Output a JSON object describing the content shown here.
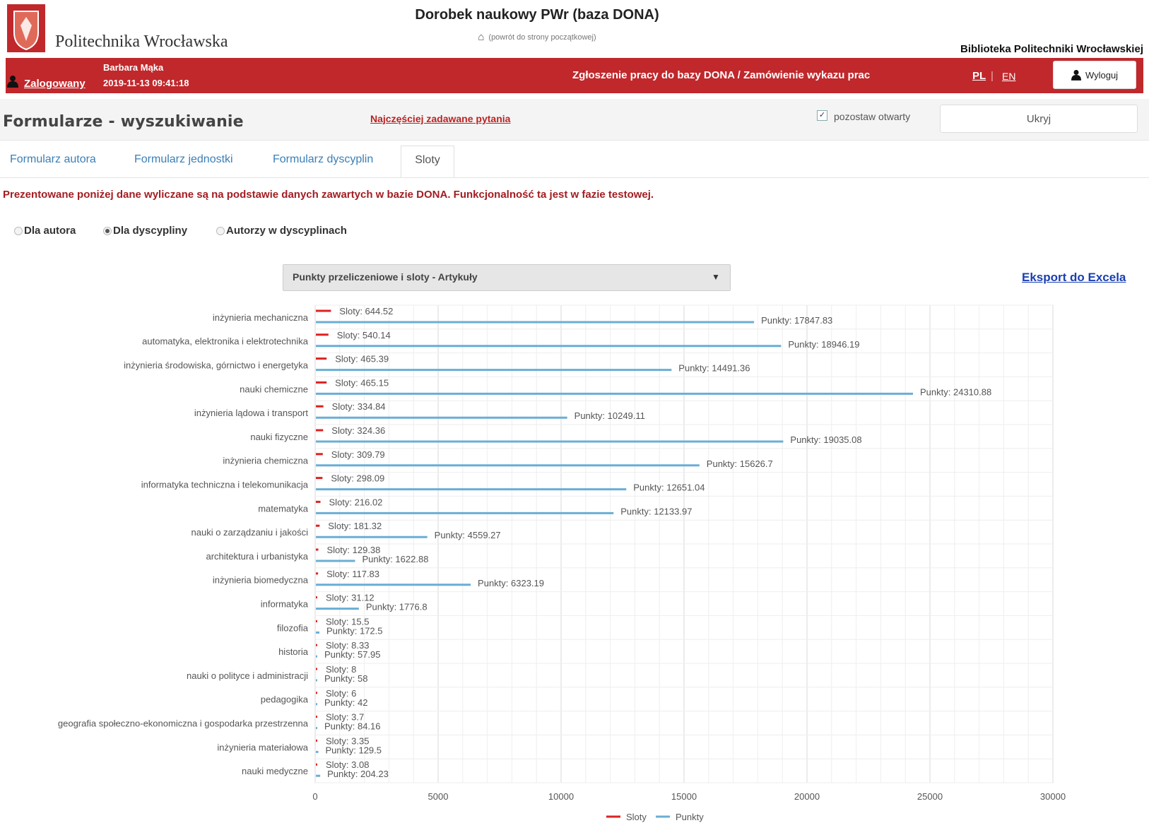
{
  "header": {
    "logo_text": "Politechnika Wrocławska",
    "title": "Dorobek naukowy PWr (baza DONA)",
    "home_link": "(powrót do strony początkowej)",
    "library": "Biblioteka Politechniki Wrocławskiej"
  },
  "userbar": {
    "logged_in": "Zalogowany",
    "user_name": "Barbara Mąka",
    "login_time": "2019-11-13 09:41:18",
    "submit_link": "Zgłoszenie pracy do bazy DONA / Zamówienie wykazu prac",
    "lang_pl": "PL",
    "lang_sep": "|",
    "lang_en": "EN",
    "logout": "Wyloguj"
  },
  "toolbar": {
    "title": "Formularze - wyszukiwanie",
    "faq": "Najczęściej zadawane pytania",
    "keep_open": "pozostaw otwarty",
    "hide": "Ukryj"
  },
  "tabs": [
    "Formularz autora",
    "Formularz jednostki",
    "Formularz dyscyplin",
    "Sloty"
  ],
  "notice": "Prezentowane poniżej dane wyliczane są na podstawie danych zawartych w bazie DONA. Funkcjonalność ta jest w fazie testowej.",
  "radios": [
    {
      "label": "Dla autora",
      "checked": false
    },
    {
      "label": "Dla dyscypliny",
      "checked": true
    },
    {
      "label": "Autorzy w dyscyplinach",
      "checked": false
    }
  ],
  "select": {
    "value": "Punkty przeliczeniowe i sloty - Artykuły"
  },
  "export": "Eksport do Excela",
  "chart_data": {
    "type": "bar",
    "orientation": "horizontal",
    "categories": [
      "inżynieria mechaniczna",
      "automatyka, elektronika i elektrotechnika",
      "inżynieria środowiska, górnictwo i energetyka",
      "nauki chemiczne",
      "inżynieria lądowa i transport",
      "nauki fizyczne",
      "inżynieria chemiczna",
      "informatyka techniczna i telekomunikacja",
      "matematyka",
      "nauki o zarządzaniu i jakości",
      "architektura i urbanistyka",
      "inżynieria biomedyczna",
      "informatyka",
      "filozofia",
      "historia",
      "nauki o polityce i administracji",
      "pedagogika",
      "geografia społeczno-ekonomiczna i gospodarka przestrzenna",
      "inżynieria materiałowa",
      "nauki medyczne"
    ],
    "series": [
      {
        "name": "Sloty",
        "color": "#dd2222",
        "values": [
          644.52,
          540.14,
          465.39,
          465.15,
          334.84,
          324.36,
          309.79,
          298.09,
          216.02,
          181.32,
          129.38,
          117.83,
          31.12,
          15.5,
          8.33,
          8,
          6,
          3.7,
          3.35,
          3.08
        ],
        "labels": [
          "Sloty: 644.52",
          "Sloty: 540.14",
          "Sloty: 465.39",
          "Sloty: 465.15",
          "Sloty: 334.84",
          "Sloty: 324.36",
          "Sloty: 309.79",
          "Sloty: 298.09",
          "Sloty: 216.02",
          "Sloty: 181.32",
          "Sloty: 129.38",
          "Sloty: 117.83",
          "Sloty: 31.12",
          "Sloty: 15.5",
          "Sloty: 8.33",
          "Sloty: 8",
          "Sloty: 6",
          "Sloty: 3.7",
          "Sloty: 3.35",
          "Sloty: 3.08"
        ]
      },
      {
        "name": "Punkty",
        "color": "#6aaed6",
        "values": [
          17847.83,
          18946.19,
          14491.36,
          24310.88,
          10249.11,
          19035.08,
          15626.7,
          12651.04,
          12133.97,
          4559.27,
          1622.88,
          6323.19,
          1776.8,
          172.5,
          57.95,
          58,
          42,
          84.16,
          129.5,
          204.23
        ],
        "labels": [
          "Punkty: 17847.83",
          "Punkty: 18946.19",
          "Punkty: 14491.36",
          "Punkty: 24310.88",
          "Punkty: 10249.11",
          "Punkty: 19035.08",
          "Punkty: 15626.7",
          "Punkty: 12651.04",
          "Punkty: 12133.97",
          "Punkty: 4559.27",
          "Punkty: 1622.88",
          "Punkty: 6323.19",
          "Punkty: 1776.8",
          "Punkty: 172.5",
          "Punkty: 57.95",
          "Punkty: 58",
          "Punkty: 42",
          "Punkty: 84.16",
          "Punkty: 129.5",
          "Punkty: 204.23"
        ]
      }
    ],
    "xlim": [
      0,
      30000
    ],
    "xticks": [
      "0",
      "5000",
      "10000",
      "15000",
      "20000",
      "25000",
      "30000"
    ],
    "grid": true,
    "legend": "bottom"
  }
}
